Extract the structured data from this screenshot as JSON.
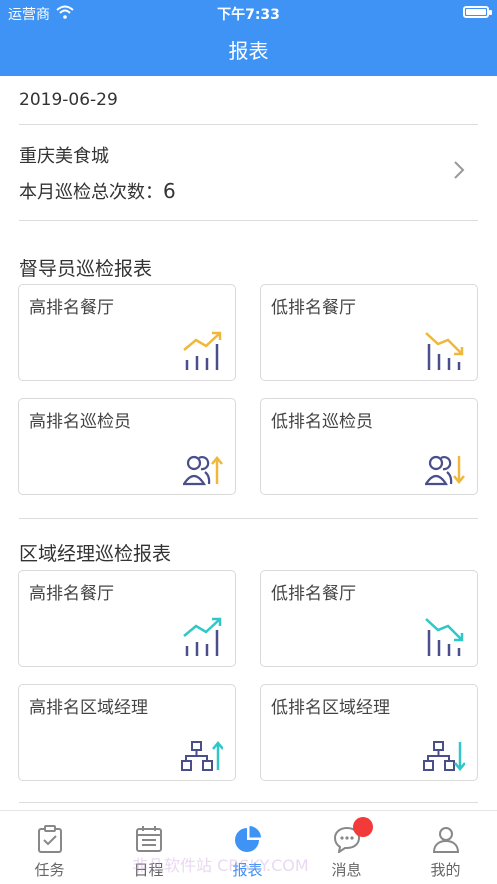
{
  "status_bar": {
    "carrier": "运营商",
    "time": "下午7:33"
  },
  "nav": {
    "title": "报表"
  },
  "date": "2019-06-29",
  "store": {
    "name": "重庆美食城",
    "count_label": "本月巡检总次数：",
    "count_value": "6"
  },
  "sections": [
    {
      "title": "督导员巡检报表",
      "cards": [
        {
          "label": "高排名餐厅",
          "icon": "trend-up-chart-icon",
          "color": "#f0b83a"
        },
        {
          "label": "低排名餐厅",
          "icon": "trend-down-chart-icon",
          "color": "#f0b83a"
        },
        {
          "label": "高排名巡检员",
          "icon": "users-arrow-up-icon",
          "color": "#f0b83a"
        },
        {
          "label": "低排名巡检员",
          "icon": "users-arrow-down-icon",
          "color": "#f0b83a"
        }
      ]
    },
    {
      "title": "区域经理巡检报表",
      "cards": [
        {
          "label": "高排名餐厅",
          "icon": "trend-up-chart-icon",
          "color": "#2fc7c7"
        },
        {
          "label": "低排名餐厅",
          "icon": "trend-down-chart-icon",
          "color": "#2fc7c7"
        },
        {
          "label": "高排名区域经理",
          "icon": "org-arrow-up-icon",
          "color": "#2fc7c7"
        },
        {
          "label": "低排名区域经理",
          "icon": "org-arrow-down-icon",
          "color": "#2fc7c7"
        }
      ]
    }
  ],
  "tabs": [
    {
      "label": "任务",
      "icon": "clipboard-check-icon"
    },
    {
      "label": "日程",
      "icon": "calendar-icon"
    },
    {
      "label": "报表",
      "icon": "pie-chart-icon",
      "active": true
    },
    {
      "label": "消息",
      "icon": "chat-bubble-icon",
      "badge": true
    },
    {
      "label": "我的",
      "icon": "user-icon"
    }
  ],
  "watermark": "非凡软件站 CRSKY.COM",
  "colors": {
    "primary": "#3e93f5",
    "accent_yellow": "#f0b83a",
    "accent_teal": "#2fc7c7",
    "icon_navy": "#4a4f8c",
    "badge_red": "#f23a3a"
  }
}
